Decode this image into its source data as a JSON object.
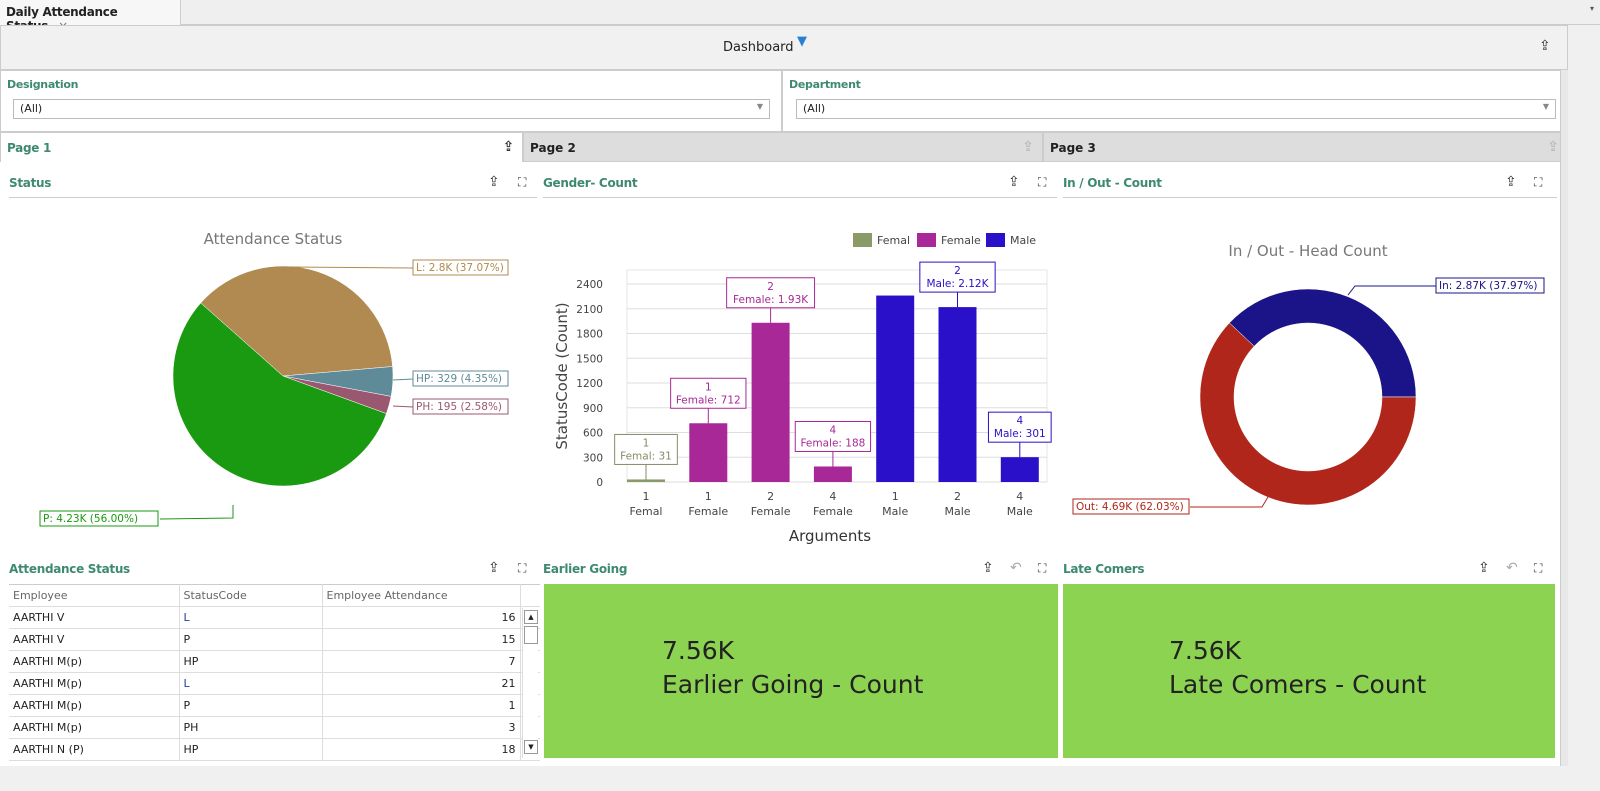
{
  "tab": {
    "title": "Daily Attendance Status",
    "close": "×"
  },
  "header": {
    "title": "Dashboard"
  },
  "filters": [
    {
      "label": "Designation",
      "value": "(All)"
    },
    {
      "label": "Department",
      "value": "(All)"
    }
  ],
  "pages": [
    "Page 1",
    "Page 2",
    "Page 3"
  ],
  "panels": {
    "status": "Status",
    "gender": "Gender- Count",
    "inout": "In / Out - Count",
    "attendance": "Attendance Status",
    "earlier": "Earlier Going",
    "late": "Late Comers"
  },
  "chart_data": [
    {
      "type": "pie",
      "title": "Attendance Status",
      "slices": [
        {
          "name": "L",
          "value": 2800,
          "percent": 37.07,
          "label": "L: 2.8K (37.07%)",
          "color": "#b08a50"
        },
        {
          "name": "HP",
          "value": 329,
          "percent": 4.35,
          "label": "HP: 329 (4.35%)",
          "color": "#5f8a98"
        },
        {
          "name": "PH",
          "value": 195,
          "percent": 2.58,
          "label": "PH: 195 (2.58%)",
          "color": "#9a5870"
        },
        {
          "name": "P",
          "value": 4230,
          "percent": 56.0,
          "label": "P: 4.23K (56.00%)",
          "color": "#1a9a10"
        }
      ]
    },
    {
      "type": "bar",
      "title": "",
      "xlabel": "Arguments",
      "ylabel": "StatusCode (Count)",
      "ylim": [
        0,
        2600
      ],
      "yticks": [
        0,
        300,
        600,
        900,
        1200,
        1500,
        1800,
        2100,
        2400
      ],
      "legend": [
        {
          "name": "Femal",
          "color": "#8a9a68"
        },
        {
          "name": "Female",
          "color": "#a82898"
        },
        {
          "name": "Male",
          "color": "#2a10c8"
        }
      ],
      "bars": [
        {
          "arg": "1",
          "series": "Femal",
          "value": 31,
          "label": "Femal: 31"
        },
        {
          "arg": "1",
          "series": "Female",
          "value": 712,
          "label": "Female: 712"
        },
        {
          "arg": "2",
          "series": "Female",
          "value": 1930,
          "label": "Female: 1.93K"
        },
        {
          "arg": "4",
          "series": "Female",
          "value": 188,
          "label": "Female: 188"
        },
        {
          "arg": "1",
          "series": "Male",
          "value": 2260,
          "label": ""
        },
        {
          "arg": "2",
          "series": "Male",
          "value": 2120,
          "label": "Male: 2.12K"
        },
        {
          "arg": "4",
          "series": "Male",
          "value": 301,
          "label": "Male: 301"
        }
      ]
    },
    {
      "type": "pie",
      "title": "In / Out - Head Count",
      "donut": true,
      "slices": [
        {
          "name": "In",
          "value": 2870,
          "percent": 37.97,
          "label": "In: 2.87K (37.97%)",
          "color": "#1a1488"
        },
        {
          "name": "Out",
          "value": 4690,
          "percent": 62.03,
          "label": "Out: 4.69K (62.03%)",
          "color": "#b0261a"
        }
      ]
    }
  ],
  "table": {
    "columns": [
      "Employee",
      "StatusCode",
      "Employee Attendance"
    ],
    "rows": [
      [
        "AARTHI  V",
        "L",
        "16"
      ],
      [
        "AARTHI  V",
        "P",
        "15"
      ],
      [
        "AARTHI M(p)",
        "HP",
        "7"
      ],
      [
        "AARTHI M(p)",
        "L",
        "21"
      ],
      [
        "AARTHI M(p)",
        "P",
        "1"
      ],
      [
        "AARTHI M(p)",
        "PH",
        "3"
      ],
      [
        "AARTHI N (P)",
        "HP",
        "18"
      ]
    ]
  },
  "kpis": [
    {
      "value": "7.56K",
      "label": "Earlier Going - Count"
    },
    {
      "value": "7.56K",
      "label": "Late Comers - Count"
    }
  ]
}
